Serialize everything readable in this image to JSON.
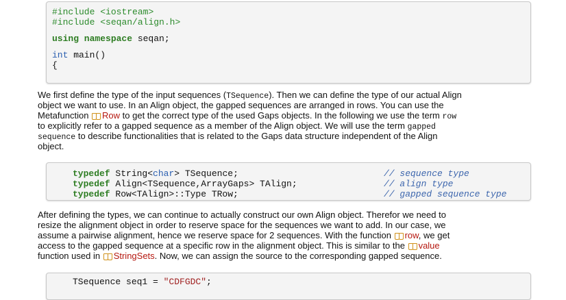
{
  "code_block_1": {
    "include_1_directive": "#include",
    "include_1_header": "<iostream>",
    "include_2_directive": "#include",
    "include_2_header": "<seqan/align.h>",
    "using_keywords": "using namespace",
    "using_rest": " seqan;",
    "main_type": "int",
    "main_rest": " main()",
    "brace": "{"
  },
  "paragraph_1": {
    "l1a": "We first define the type of the input sequences (",
    "l1b": "TSequence",
    "l1c": "). Then we can define the type of our actual Align",
    "l2": "object we want to use. In an Align object, the gapped sequences are arranged in rows. You can use the",
    "l3a": "Metafunction ",
    "l3link": "Row",
    "l3b": " to get the correct type of the used Gaps objects. In the following we use the term ",
    "l3c": "row",
    "l4": "to explicitly refer to a gapped sequence as a member of the Align object. We will use the term ",
    "l4b": "gapped",
    "l5a": "sequence",
    "l5b": " to describe functionalities that is related to the Gaps data structure independent of the Align",
    "l6": "object."
  },
  "code_block_2": {
    "r1_kw": "typedef",
    "r1_a": " String<",
    "r1_ty": "char",
    "r1_b": "> TSequence;",
    "r1_cm": "// sequence type",
    "r2_kw": "typedef",
    "r2_a": " Align<TSequence,ArrayGaps> TAlign;",
    "r2_cm": "// align type",
    "r3_kw": "typedef",
    "r3_a": " Row<TAlign>::Type TRow;",
    "r3_cm": "// gapped sequence type"
  },
  "paragraph_2": {
    "l1": "After defining the types, we can continue to actually construct our own Align object. Therefor we need to",
    "l2": "resize the alignment object in order to reserve space for the sequences we want to add. In our case, we",
    "l3": "assume a pairwise alignment, hence we reserve space for 2 sequences. With the function ",
    "l3link": "row",
    "l3b": ", we get",
    "l4": "access to the gapped sequence at a specific row in the alignment object. This is similar to the ",
    "l4link": "value",
    "l5a": "function used in ",
    "l5link": "StringSets",
    "l5b": ". Now, we can assign the source to the corresponding gapped sequence."
  },
  "code_block_3": {
    "a": "TSequence seq1 = ",
    "str": "\"CDFGDC\"",
    "b": ";"
  },
  "colors": {
    "keyword": "#2e7d23",
    "preprocessor": "#2b8a2b",
    "type": "#2b5fb0",
    "comment": "#3d66ad",
    "string": "#a02222",
    "link": "#b5170f",
    "code_bg": "#f4f4f4"
  },
  "icons": [
    "book-icon"
  ]
}
